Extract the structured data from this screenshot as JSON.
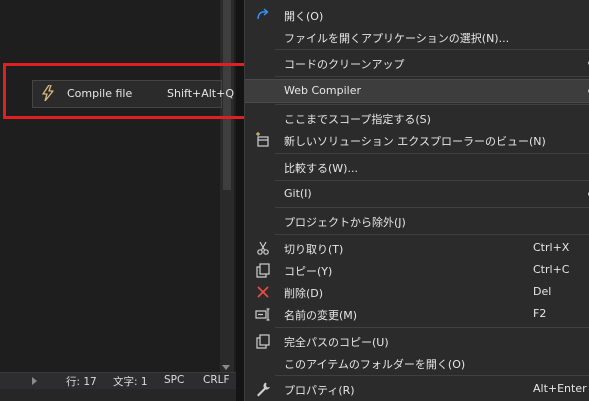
{
  "editor": {
    "status": {
      "line": "行: 17",
      "col": "文字: 1",
      "spc": "SPC",
      "crlf": "CRLF"
    }
  },
  "popup": {
    "label": "Compile file",
    "shortcut": "Shift+Alt+Q",
    "icon": "lightning-icon"
  },
  "menu": {
    "items": [
      {
        "label": "開く(O)",
        "icon": "redirect-arrow-icon"
      },
      {
        "label": "ファイルを開くアプリケーションの選択(N)..."
      },
      {
        "label": "コードのクリーンアップ",
        "submenu": true
      },
      {
        "label": "Web Compiler",
        "submenu": true,
        "highlighted": true
      },
      {
        "label": "ここまでスコープ指定する(S)"
      },
      {
        "label": "新しいソリューション エクスプローラーのビュー(N)",
        "icon": "new-view-icon"
      },
      {
        "label": "比較する(W)..."
      },
      {
        "label": "Git(I)",
        "submenu": true
      },
      {
        "label": "プロジェクトから除外(J)"
      },
      {
        "label": "切り取り(T)",
        "shortcut": "Ctrl+X",
        "icon": "scissors-icon"
      },
      {
        "label": "コピー(Y)",
        "shortcut": "Ctrl+C",
        "icon": "copy-icon"
      },
      {
        "label": "削除(D)",
        "shortcut": "Del",
        "icon": "delete-x-icon"
      },
      {
        "label": "名前の変更(M)",
        "shortcut": "F2",
        "icon": "rename-icon"
      },
      {
        "label": "完全パスのコピー(U)",
        "icon": "copy-path-icon"
      },
      {
        "label": "このアイテムのフォルダーを開く(O)"
      },
      {
        "label": "プロパティ(R)",
        "shortcut": "Alt+Enter",
        "icon": "wrench-icon"
      }
    ]
  },
  "colors": {
    "accent": "#3794ff",
    "highlight": "#3d3d3d",
    "annotation": "#e02020",
    "bolt": "#d7ba7d",
    "delete": "#f14c4c"
  }
}
